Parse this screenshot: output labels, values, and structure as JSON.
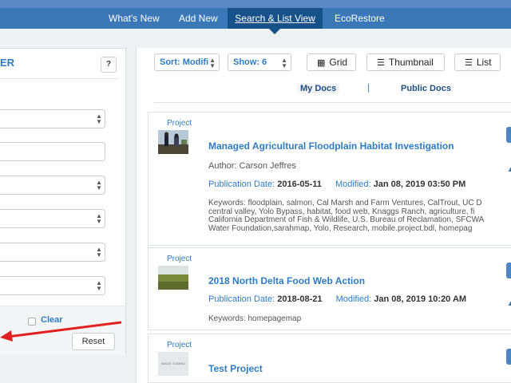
{
  "nav": {
    "items": [
      "What's New",
      "Add New",
      "Search & List View",
      "EcoRestore"
    ]
  },
  "filter": {
    "title": "ER",
    "help_label": "?",
    "clear_label": "Clear",
    "reset_label": "Reset"
  },
  "toolbar": {
    "sort_label": "Sort: Modifi",
    "show_label": "Show: 6",
    "grid_label": "Grid",
    "thumbnail_label": "Thumbnail",
    "list_label": "List"
  },
  "tabs": {
    "my_docs": "My Docs",
    "separator": "|",
    "public_docs": "Public Docs"
  },
  "cards": [
    {
      "type": "Project",
      "title": "Managed Agricultural Floodplain Habitat Investigation",
      "author": "Author: Carson Jeffres",
      "pub_label": "Publication Date:",
      "pub_date": "2016-05-11",
      "mod_label": "Modified:",
      "mod_date": "Jan 08, 2019 03:50 PM",
      "keywords": [
        "Keywords: floodplain, salmon, Cal Marsh and Farm Ventures, CalTrout, UC D",
        "central valley, Yolo Bypass, habitat, food web, Knaggs Ranch, agriculture, fi",
        "California Department of Fish & Wildlife, U.S. Bureau of Reclamation, SFCWA",
        "Water Foundation,sarahmap, Yolo, Research, mobile.project.bdl, homepag"
      ]
    },
    {
      "type": "Project",
      "title": "2018 North Delta Food Web Action",
      "pub_label": "Publication Date:",
      "pub_date": "2018-08-21",
      "mod_label": "Modified:",
      "mod_date": "Jan 08, 2019 10:20 AM",
      "keywords": [
        "Keywords: homepagemap"
      ]
    },
    {
      "type": "Project",
      "title": "Test Project",
      "thumb_text": "IMAGE COMING SOON"
    }
  ],
  "colors": {
    "nav_bg": "#3a78b8",
    "nav_active": "#17518a",
    "link_blue": "#2f7cc2",
    "annotation_red": "#e02020"
  }
}
